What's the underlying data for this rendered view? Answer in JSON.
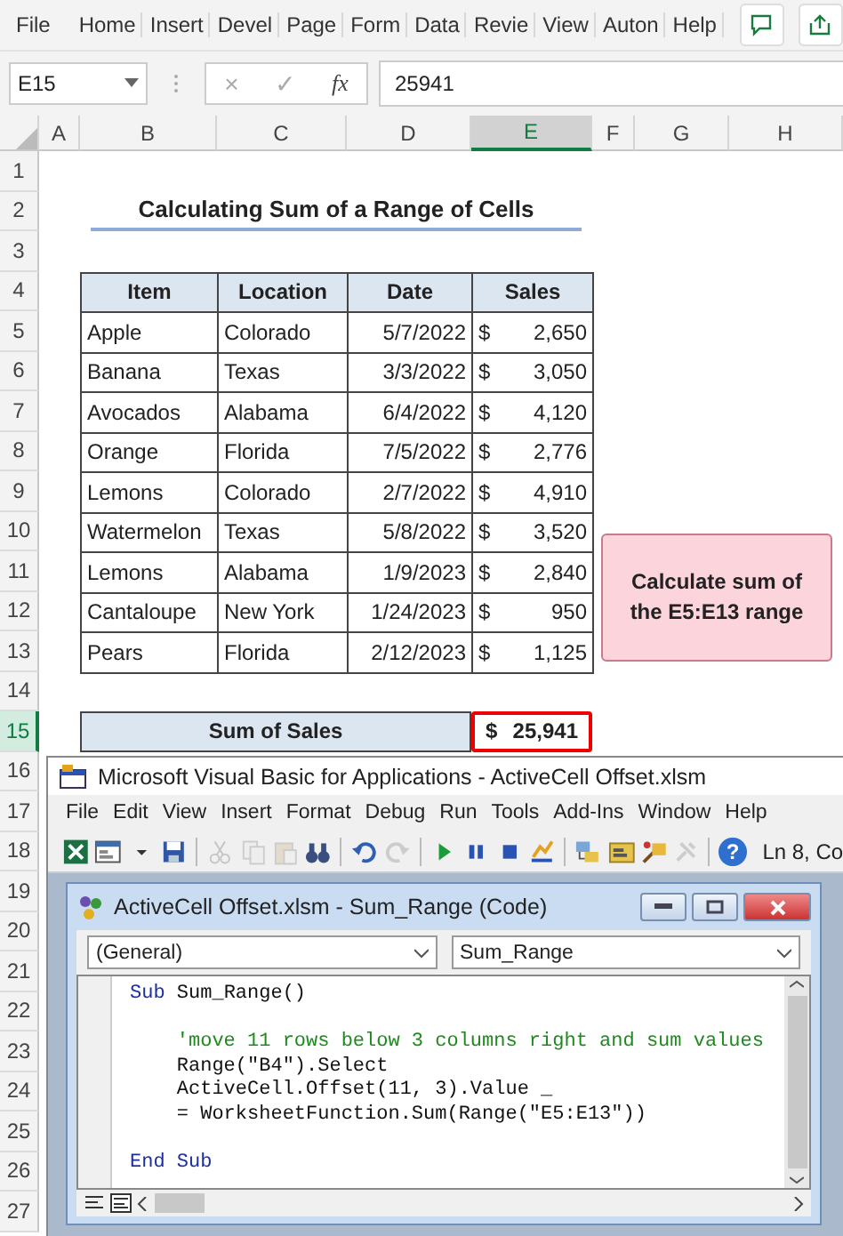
{
  "ribbon": {
    "tabs": [
      {
        "label": "File"
      },
      {
        "label": "Home"
      },
      {
        "label": "Insert"
      },
      {
        "label": "Devel"
      },
      {
        "label": "Page"
      },
      {
        "label": "Form"
      },
      {
        "label": "Data"
      },
      {
        "label": "Revie"
      },
      {
        "label": "View"
      },
      {
        "label": "Auton"
      },
      {
        "label": "Help"
      }
    ]
  },
  "formula_bar": {
    "name_box": "E15",
    "cancel": "×",
    "enter": "✓",
    "fx": "fx",
    "value": "25941"
  },
  "columns": [
    {
      "label": "A",
      "selected": false
    },
    {
      "label": "B",
      "selected": false
    },
    {
      "label": "C",
      "selected": false
    },
    {
      "label": "D",
      "selected": false
    },
    {
      "label": "E",
      "selected": true
    },
    {
      "label": "F",
      "selected": false
    },
    {
      "label": "G",
      "selected": false
    },
    {
      "label": "H",
      "selected": false
    }
  ],
  "rows": [
    {
      "label": "1",
      "selected": false
    },
    {
      "label": "2",
      "selected": false
    },
    {
      "label": "3",
      "selected": false
    },
    {
      "label": "4",
      "selected": false
    },
    {
      "label": "5",
      "selected": false
    },
    {
      "label": "6",
      "selected": false
    },
    {
      "label": "7",
      "selected": false
    },
    {
      "label": "8",
      "selected": false
    },
    {
      "label": "9",
      "selected": false
    },
    {
      "label": "10",
      "selected": false
    },
    {
      "label": "11",
      "selected": false
    },
    {
      "label": "12",
      "selected": false
    },
    {
      "label": "13",
      "selected": false
    },
    {
      "label": "14",
      "selected": false
    },
    {
      "label": "15",
      "selected": true
    },
    {
      "label": "16",
      "selected": false
    },
    {
      "label": "17",
      "selected": false
    },
    {
      "label": "18",
      "selected": false
    },
    {
      "label": "19",
      "selected": false
    },
    {
      "label": "20",
      "selected": false
    },
    {
      "label": "21",
      "selected": false
    },
    {
      "label": "22",
      "selected": false
    },
    {
      "label": "23",
      "selected": false
    },
    {
      "label": "24",
      "selected": false
    },
    {
      "label": "25",
      "selected": false
    },
    {
      "label": "26",
      "selected": false
    },
    {
      "label": "27",
      "selected": false
    }
  ],
  "sheet_title": "Calculating Sum of a Range of Cells",
  "table": {
    "columns": [
      "Item",
      "Location",
      "Date",
      "Sales"
    ],
    "rows": [
      {
        "item": "Apple",
        "location": "Colorado",
        "date": "5/7/2022",
        "currency": "$",
        "sales": "2,650"
      },
      {
        "item": "Banana",
        "location": "Texas",
        "date": "3/3/2022",
        "currency": "$",
        "sales": "3,050"
      },
      {
        "item": "Avocados",
        "location": "Alabama",
        "date": "6/4/2022",
        "currency": "$",
        "sales": "4,120"
      },
      {
        "item": "Orange",
        "location": "Florida",
        "date": "7/5/2022",
        "currency": "$",
        "sales": "2,776"
      },
      {
        "item": "Lemons",
        "location": "Colorado",
        "date": "2/7/2022",
        "currency": "$",
        "sales": "4,910"
      },
      {
        "item": "Watermelon",
        "location": "Texas",
        "date": "5/8/2022",
        "currency": "$",
        "sales": "3,520"
      },
      {
        "item": "Lemons",
        "location": "Alabama",
        "date": "1/9/2023",
        "currency": "$",
        "sales": "2,840"
      },
      {
        "item": "Cantaloupe",
        "location": "New York",
        "date": "1/24/2023",
        "currency": "$",
        "sales": "950"
      },
      {
        "item": "Pears",
        "location": "Florida",
        "date": "2/12/2023",
        "currency": "$",
        "sales": "1,125"
      }
    ]
  },
  "sum_row": {
    "label": "Sum of Sales",
    "currency": "$",
    "value": "25,941"
  },
  "note": "Calculate sum of the E5:E13 range",
  "vba": {
    "title": "Microsoft Visual Basic for Applications - ActiveCell Offset.xlsm",
    "menu": [
      "File",
      "Edit",
      "View",
      "Insert",
      "Format",
      "Debug",
      "Run",
      "Tools",
      "Add-Ins",
      "Window",
      "Help"
    ],
    "toolbar": [
      {
        "kind": "excel",
        "disabled": false
      },
      {
        "kind": "form",
        "disabled": false
      },
      {
        "kind": "caret",
        "disabled": false
      },
      {
        "kind": "save",
        "disabled": false
      },
      {
        "kind": "sep"
      },
      {
        "kind": "cut",
        "disabled": true
      },
      {
        "kind": "copy",
        "disabled": true
      },
      {
        "kind": "paste",
        "disabled": true
      },
      {
        "kind": "find",
        "disabled": false
      },
      {
        "kind": "sep"
      },
      {
        "kind": "undo",
        "disabled": false
      },
      {
        "kind": "redo",
        "disabled": true
      },
      {
        "kind": "sep"
      },
      {
        "kind": "run",
        "disabled": false
      },
      {
        "kind": "pause",
        "disabled": false
      },
      {
        "kind": "stop",
        "disabled": false
      },
      {
        "kind": "design",
        "disabled": false
      },
      {
        "kind": "sep"
      },
      {
        "kind": "explorer",
        "disabled": false
      },
      {
        "kind": "properties",
        "disabled": false
      },
      {
        "kind": "browser",
        "disabled": false
      },
      {
        "kind": "toolbox",
        "disabled": true
      },
      {
        "kind": "sep"
      },
      {
        "kind": "help",
        "label": "?",
        "disabled": false
      }
    ],
    "position": "Ln 8, Co",
    "code_window": {
      "title": "ActiveCell Offset.xlsm - Sum_Range (Code)",
      "object": "(General)",
      "procedure": "Sum_Range",
      "lines": [
        {
          "kind": "code",
          "segments": [
            {
              "kind": "keyword",
              "text": "Sub"
            },
            {
              "kind": "plain",
              "text": " Sum_Range()"
            }
          ]
        },
        {
          "kind": "blank"
        },
        {
          "kind": "code",
          "segments": [
            {
              "kind": "comment",
              "text": "    'move 11 rows below 3 columns right and sum values"
            }
          ]
        },
        {
          "kind": "code",
          "segments": [
            {
              "kind": "plain",
              "text": "    Range(\"B4\").Select"
            }
          ]
        },
        {
          "kind": "code",
          "segments": [
            {
              "kind": "plain",
              "text": "    ActiveCell.Offset(11, 3).Value _"
            }
          ]
        },
        {
          "kind": "code",
          "segments": [
            {
              "kind": "plain",
              "text": "    = WorksheetFunction.Sum(Range(\"E5:E13\"))"
            }
          ]
        },
        {
          "kind": "blank"
        },
        {
          "kind": "code",
          "segments": [
            {
              "kind": "keyword",
              "text": "End Sub"
            }
          ]
        }
      ]
    }
  }
}
